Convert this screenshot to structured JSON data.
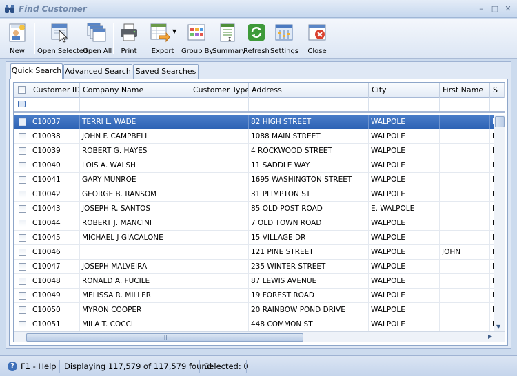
{
  "window": {
    "title": "Find Customer"
  },
  "toolbar": {
    "new": "New",
    "open_selected": "Open Selected",
    "open_all": "Open All",
    "print": "Print",
    "export": "Export",
    "group_by": "Group By",
    "summary": "Summary",
    "refresh": "Refresh",
    "settings": "Settings",
    "close": "Close"
  },
  "tabs": [
    "Quick Search",
    "Advanced Search",
    "Saved Searches"
  ],
  "grid": {
    "columns": [
      "Customer ID",
      "Company Name",
      "Customer Type",
      "Address",
      "City",
      "First Name",
      "S"
    ],
    "rows": [
      {
        "id": "C10037",
        "company": "TERRI L. WADE",
        "type": "",
        "address": "82 HIGH STREET",
        "city": "WALPOLE",
        "first": "",
        "s": "M",
        "selected": true
      },
      {
        "id": "C10038",
        "company": "JOHN F. CAMPBELL",
        "type": "",
        "address": "1088 MAIN STREET",
        "city": "WALPOLE",
        "first": "",
        "s": "M"
      },
      {
        "id": "C10039",
        "company": "ROBERT G. HAYES",
        "type": "",
        "address": "4 ROCKWOOD STREET",
        "city": "WALPOLE",
        "first": "",
        "s": "M"
      },
      {
        "id": "C10040",
        "company": "LOIS A. WALSH",
        "type": "",
        "address": "11 SADDLE WAY",
        "city": "WALPOLE",
        "first": "",
        "s": "M"
      },
      {
        "id": "C10041",
        "company": "GARY MUNROE",
        "type": "",
        "address": "1695 WASHINGTON STREET",
        "city": "WALPOLE",
        "first": "",
        "s": "M"
      },
      {
        "id": "C10042",
        "company": "GEORGE B. RANSOM",
        "type": "",
        "address": "31 PLIMPTON ST",
        "city": "WALPOLE",
        "first": "",
        "s": "M"
      },
      {
        "id": "C10043",
        "company": "JOSEPH R. SANTOS",
        "type": "",
        "address": "85 OLD POST ROAD",
        "city": "E. WALPOLE",
        "first": "",
        "s": "M"
      },
      {
        "id": "C10044",
        "company": "ROBERT J. MANCINI",
        "type": "",
        "address": "7 OLD TOWN ROAD",
        "city": "WALPOLE",
        "first": "",
        "s": "M"
      },
      {
        "id": "C10045",
        "company": "MICHAEL J GIACALONE",
        "type": "",
        "address": "15 VILLAGE DR",
        "city": "WALPOLE",
        "first": "",
        "s": "M"
      },
      {
        "id": "C10046",
        "company": "",
        "type": "",
        "address": "121 PINE STREET",
        "city": "WALPOLE",
        "first": "JOHN",
        "s": "M"
      },
      {
        "id": "C10047",
        "company": "JOSEPH MALVEIRA",
        "type": "",
        "address": "235 WINTER STREET",
        "city": "WALPOLE",
        "first": "",
        "s": "M"
      },
      {
        "id": "C10048",
        "company": "RONALD A. FUCILE",
        "type": "",
        "address": "87 LEWIS AVENUE",
        "city": "WALPOLE",
        "first": "",
        "s": "M"
      },
      {
        "id": "C10049",
        "company": "MELISSA R. MILLER",
        "type": "",
        "address": "19 FOREST ROAD",
        "city": "WALPOLE",
        "first": "",
        "s": "M"
      },
      {
        "id": "C10050",
        "company": "MYRON COOPER",
        "type": "",
        "address": "20 RAINBOW POND DRIVE",
        "city": "WALPOLE",
        "first": "",
        "s": "M"
      },
      {
        "id": "C10051",
        "company": "MILA T. COCCI",
        "type": "",
        "address": "448 COMMON ST",
        "city": "WALPOLE",
        "first": "",
        "s": "M"
      }
    ]
  },
  "status": {
    "help": "F1 - Help",
    "displaying": "Displaying 117,579 of 117,579 found",
    "selected": "Selected: 0"
  },
  "colors": {
    "selection": "#2e63b5",
    "frame": "#ccdbee"
  }
}
